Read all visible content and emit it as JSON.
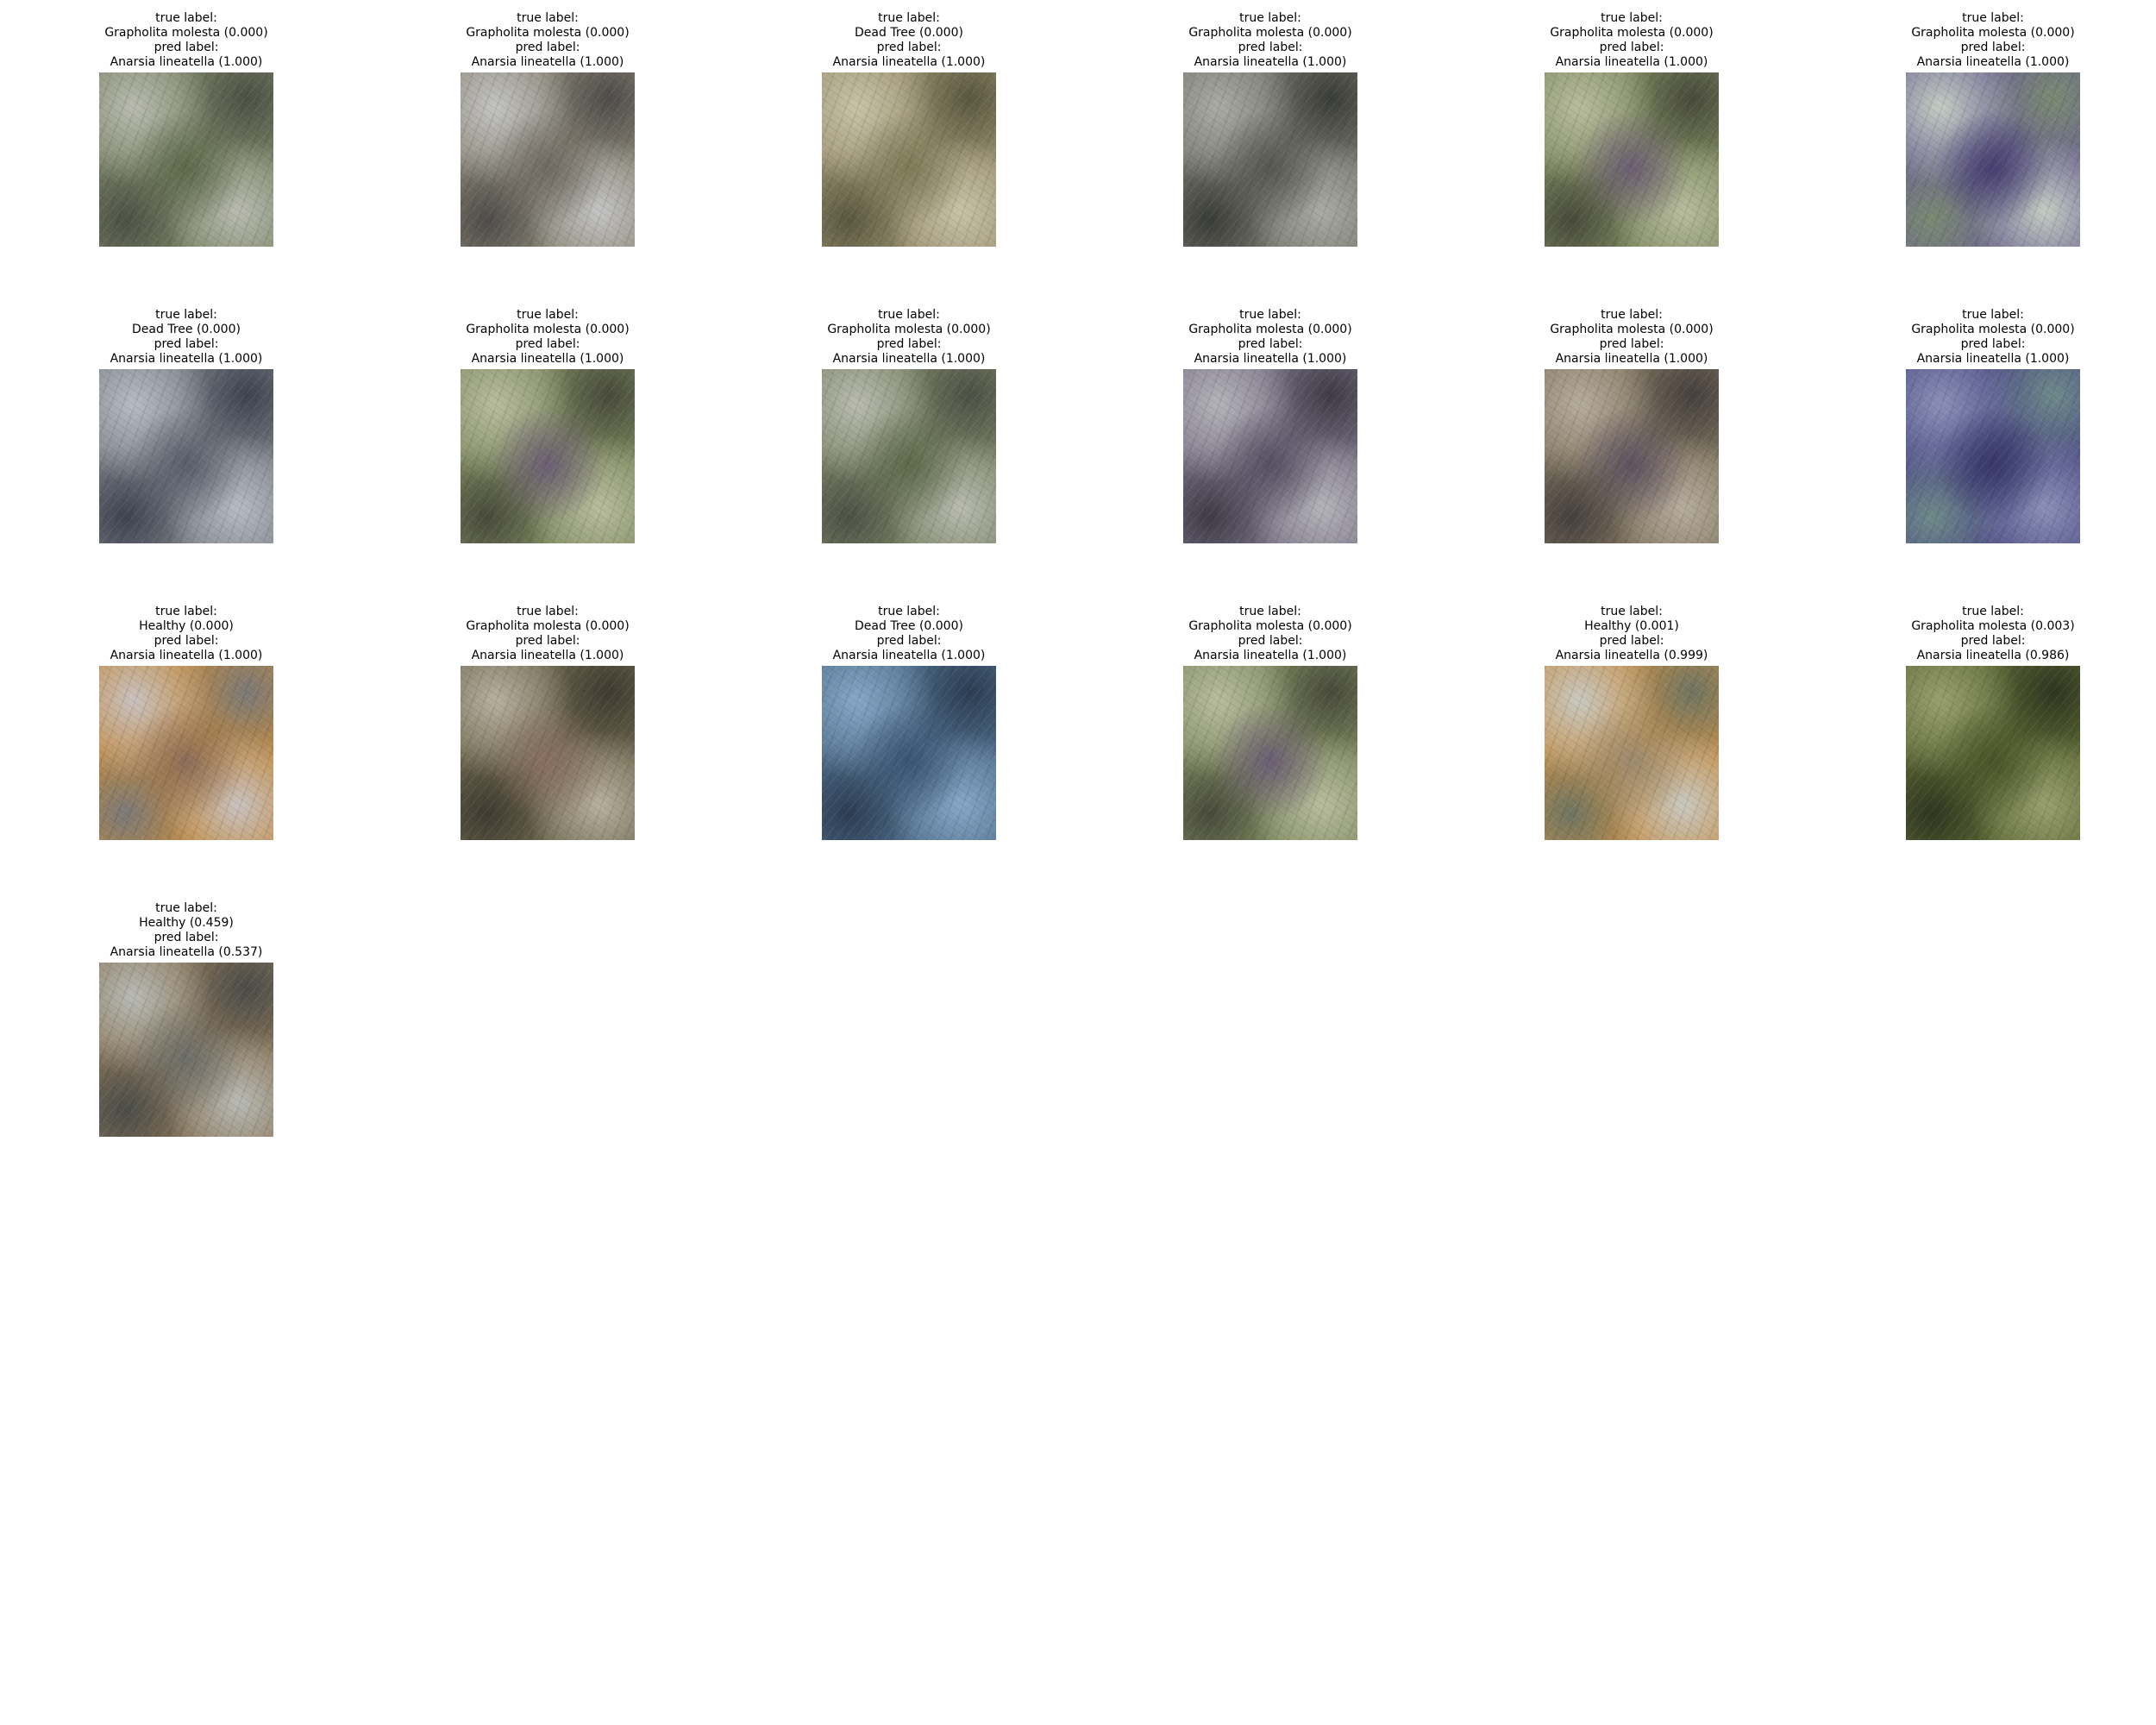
{
  "figure": {
    "panels": [
      {
        "true_heading": "true label:",
        "true_value": "Grapholita molesta (0.000)",
        "pred_heading": "pred label:",
        "pred_value": "Anarsia lineatella (1.000)",
        "tone": "green-grey"
      },
      {
        "true_heading": "true label:",
        "true_value": "Grapholita molesta (0.000)",
        "pred_heading": "pred label:",
        "pred_value": "Anarsia lineatella (1.000)",
        "tone": "grey-brown"
      },
      {
        "true_heading": "true label:",
        "true_value": "Dead Tree (0.000)",
        "pred_heading": "pred label:",
        "pred_value": "Anarsia lineatella (1.000)",
        "tone": "olive"
      },
      {
        "true_heading": "true label:",
        "true_value": "Grapholita molesta (0.000)",
        "pred_heading": "pred label:",
        "pred_value": "Anarsia lineatella (1.000)",
        "tone": "grey-dark"
      },
      {
        "true_heading": "true label:",
        "true_value": "Grapholita molesta (0.000)",
        "pred_heading": "pred label:",
        "pred_value": "Anarsia lineatella (1.000)",
        "tone": "green-purple"
      },
      {
        "true_heading": "true label:",
        "true_value": "Grapholita molesta (0.000)",
        "pred_heading": "pred label:",
        "pred_value": "Anarsia lineatella (1.000)",
        "tone": "purple-light"
      },
      {
        "true_heading": "true label:",
        "true_value": "Dead Tree (0.000)",
        "pred_heading": "pred label:",
        "pred_value": "Anarsia lineatella (1.000)",
        "tone": "grey-blue"
      },
      {
        "true_heading": "true label:",
        "true_value": "Grapholita molesta (0.000)",
        "pred_heading": "pred label:",
        "pred_value": "Anarsia lineatella (1.000)",
        "tone": "green-purple"
      },
      {
        "true_heading": "true label:",
        "true_value": "Grapholita molesta (0.000)",
        "pred_heading": "pred label:",
        "pred_value": "Anarsia lineatella (1.000)",
        "tone": "green-grey"
      },
      {
        "true_heading": "true label:",
        "true_value": "Grapholita molesta (0.000)",
        "pred_heading": "pred label:",
        "pred_value": "Anarsia lineatella (1.000)",
        "tone": "purple-grey"
      },
      {
        "true_heading": "true label:",
        "true_value": "Grapholita molesta (0.000)",
        "pred_heading": "pred label:",
        "pred_value": "Anarsia lineatella (1.000)",
        "tone": "brown-purple"
      },
      {
        "true_heading": "true label:",
        "true_value": "Grapholita molesta (0.000)",
        "pred_heading": "pred label:",
        "pred_value": "Anarsia lineatella (1.000)",
        "tone": "deep-purple"
      },
      {
        "true_heading": "true label:",
        "true_value": "Healthy (0.000)",
        "pred_heading": "pred label:",
        "pred_value": "Anarsia lineatella (1.000)",
        "tone": "orange"
      },
      {
        "true_heading": "true label:",
        "true_value": "Grapholita molesta (0.000)",
        "pred_heading": "pred label:",
        "pred_value": "Anarsia lineatella (1.000)",
        "tone": "dark-mixed"
      },
      {
        "true_heading": "true label:",
        "true_value": "Dead Tree (0.000)",
        "pred_heading": "pred label:",
        "pred_value": "Anarsia lineatella (1.000)",
        "tone": "blue"
      },
      {
        "true_heading": "true label:",
        "true_value": "Grapholita molesta (0.000)",
        "pred_heading": "pred label:",
        "pred_value": "Anarsia lineatella (1.000)",
        "tone": "green-purple"
      },
      {
        "true_heading": "true label:",
        "true_value": "Healthy (0.001)",
        "pred_heading": "pred label:",
        "pred_value": "Anarsia lineatella (0.999)",
        "tone": "orange-light"
      },
      {
        "true_heading": "true label:",
        "true_value": "Grapholita molesta (0.003)",
        "pred_heading": "pred label:",
        "pred_value": "Anarsia lineatella (0.986)",
        "tone": "green-dark"
      },
      {
        "true_heading": "true label:",
        "true_value": "Healthy (0.459)",
        "pred_heading": "pred label:",
        "pred_value": "Anarsia lineatella (0.537)",
        "tone": "brown-grey"
      }
    ]
  }
}
